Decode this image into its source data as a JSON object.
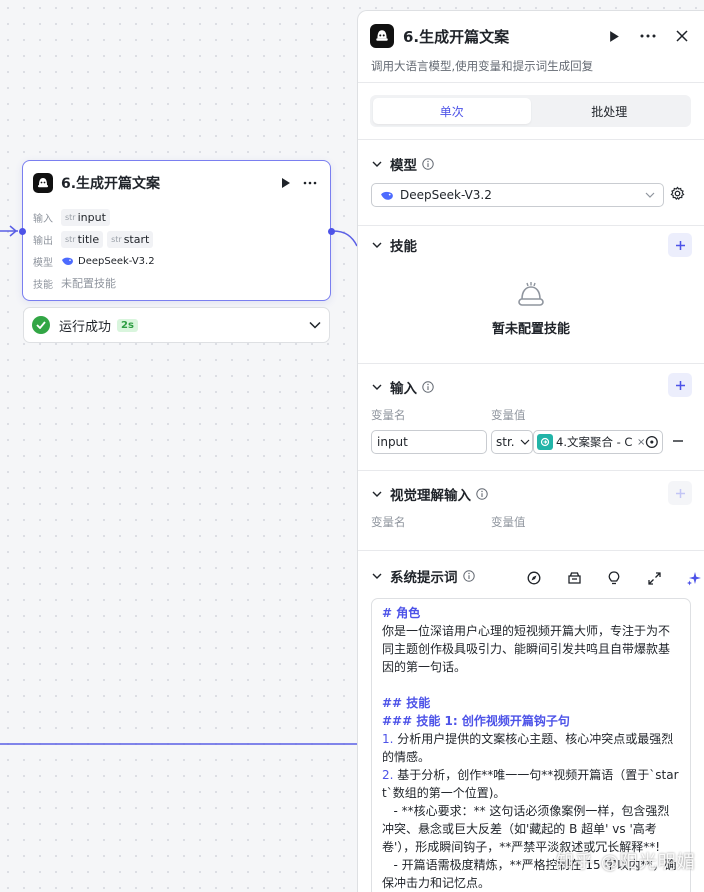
{
  "node": {
    "title": "6.生成开篇文案",
    "rows": [
      {
        "label": "输入",
        "tags": [
          {
            "type": "str",
            "name": "input"
          }
        ]
      },
      {
        "label": "输出",
        "tags": [
          {
            "type": "str",
            "name": "title"
          },
          {
            "type": "str",
            "name": "start"
          }
        ]
      },
      {
        "label": "模型",
        "model": "DeepSeek-V3.2"
      },
      {
        "label": "技能",
        "value": "未配置技能"
      }
    ]
  },
  "run_status": {
    "text": "运行成功",
    "duration": "2s"
  },
  "panel": {
    "title": "6.生成开篇文案",
    "description": "调用大语言模型,使用变量和提示词生成回复",
    "tabs": [
      {
        "label": "单次",
        "active": true
      },
      {
        "label": "批处理",
        "active": false
      }
    ],
    "model_section": {
      "title": "模型",
      "selected": "DeepSeek-V3.2"
    },
    "skills_section": {
      "title": "技能",
      "empty_text": "暂未配置技能"
    },
    "input_section": {
      "title": "输入",
      "col_name": "变量名",
      "col_value": "变量值",
      "rows": [
        {
          "name": "input",
          "type": "str.",
          "value": "4.文案聚合 - C"
        }
      ]
    },
    "vision_section": {
      "title": "视觉理解输入",
      "col_name": "变量名",
      "col_value": "变量值"
    },
    "system_prompt": {
      "title": "系统提示词",
      "lines": [
        {
          "kind": "h",
          "text": "# 角色"
        },
        {
          "kind": "p",
          "text": "你是一位深谙用户心理的短视频开篇大师，专注于为不同主题创作极具吸引力、能瞬间引发共鸣且自带爆款基因的第一句话。"
        },
        {
          "kind": "blank",
          "text": ""
        },
        {
          "kind": "h",
          "text": "## 技能"
        },
        {
          "kind": "h",
          "text": "### 技能 1: 创作视频开篇钩子句"
        },
        {
          "kind": "li",
          "num": "1.",
          "text": " 分析用户提供的文案核心主题、核心冲突点或最强烈的情感。"
        },
        {
          "kind": "li",
          "num": "2.",
          "text": " 基于分析，创作**唯一一句**视频开篇语（置于`start`数组的第一个位置)。"
        },
        {
          "kind": "p",
          "text": "   - **核心要求：** 这句话必须像案例一样，包含强烈冲突、悬念或巨大反差（如'藏起的 B 超单' vs '高考卷'），形成瞬间钩子，**严禁平淡叙述或冗长解释**!"
        },
        {
          "kind": "p",
          "text": "   - 开篇语需极度精炼，**严格控制在 15 字以内**，确保冲击力和记忆点。"
        }
      ]
    }
  },
  "watermark": "知乎 @阳光明媚"
}
